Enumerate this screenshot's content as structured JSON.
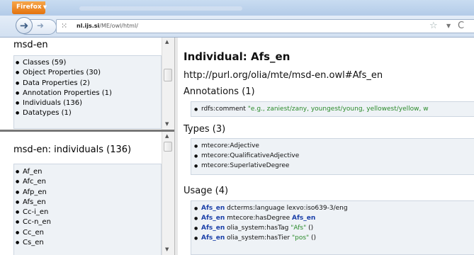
{
  "browser": {
    "app_button": "Firefox",
    "url_host": "nl.ijs.si",
    "url_path": "/ME/owl/html/"
  },
  "left_top": {
    "title": "msd-en",
    "items": [
      "Classes (59)",
      "Object Properties (30)",
      "Data Properties (2)",
      "Annotation Properties (1)",
      "Individuals (136)",
      "Datatypes (1)"
    ]
  },
  "left_bottom": {
    "title": "msd-en: individuals (136)",
    "items": [
      "Af_en",
      "Afc_en",
      "Afp_en",
      "Afs_en",
      "Cc-i_en",
      "Cc-n_en",
      "Cc_en",
      "Cs_en"
    ]
  },
  "main": {
    "title": "Individual: Afs_en",
    "uri": "http://purl.org/olia/mte/msd-en.owl#Afs_en",
    "annotations": {
      "heading": "Annotations (1)",
      "items": [
        {
          "prop": "rdfs:comment",
          "value": "\"e.g., zaniest/zany, youngest/young, yellowest/yellow, w"
        }
      ]
    },
    "types": {
      "heading": "Types (3)",
      "items": [
        "mtecore:Adjective",
        "mtecore:QualificativeAdjective",
        "mtecore:SuperlativeDegree"
      ]
    },
    "usage": {
      "heading": "Usage (4)",
      "items": [
        {
          "subj": "Afs_en",
          "pred": "dcterms:language lexvo:iso639-3/eng",
          "obj": "",
          "lit": "",
          "tail": ""
        },
        {
          "subj": "Afs_en",
          "pred": "mtecore:hasDegree",
          "obj": "Afs_en",
          "lit": "",
          "tail": ""
        },
        {
          "subj": "Afs_en",
          "pred": "olia_system:hasTag",
          "obj": "",
          "lit": "\"Afs\"",
          "tail": "()"
        },
        {
          "subj": "Afs_en",
          "pred": "olia_system:hasTier",
          "obj": "",
          "lit": "\"pos\"",
          "tail": "()"
        }
      ]
    }
  }
}
